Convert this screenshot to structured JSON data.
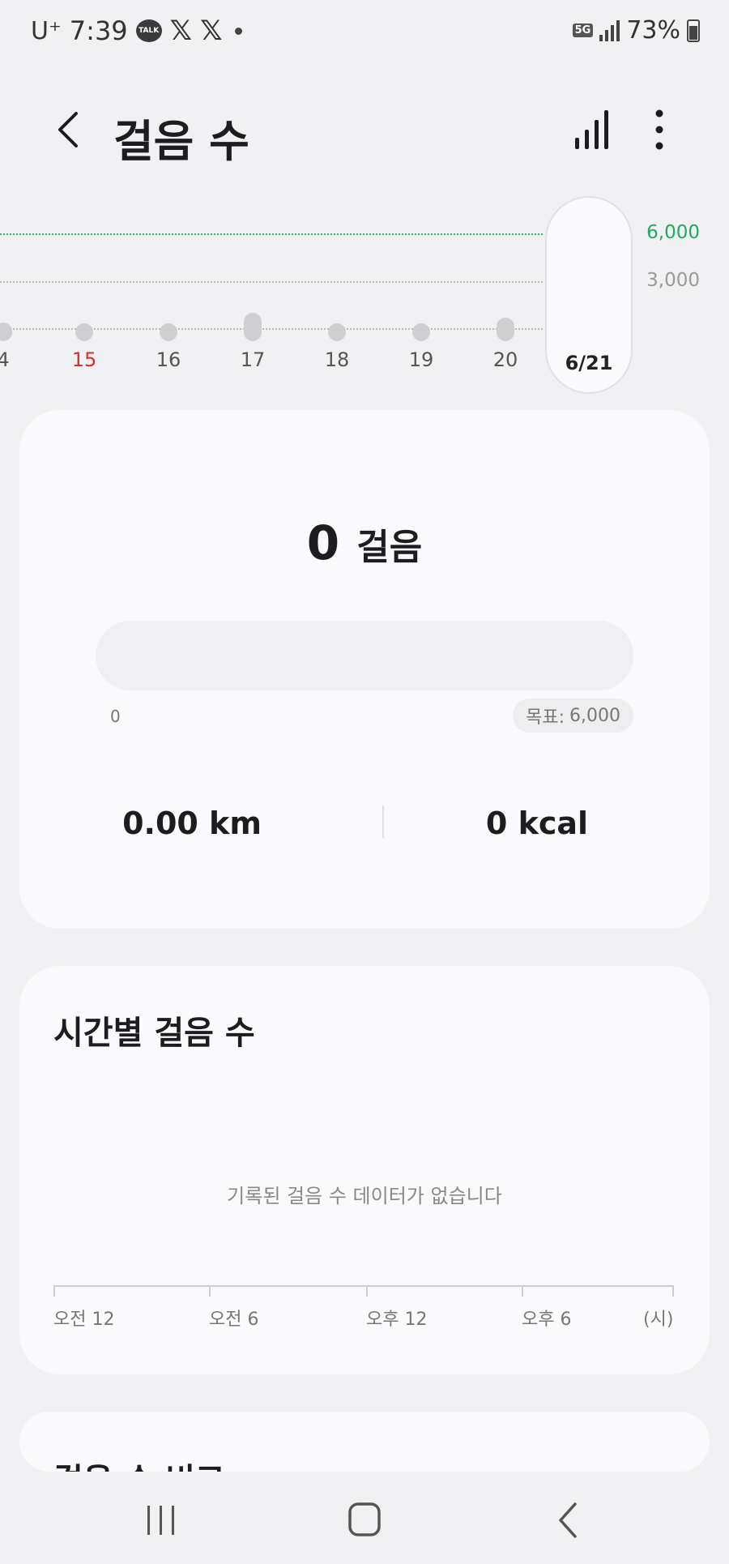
{
  "status_bar": {
    "carrier": "U⁺",
    "time": "7:39",
    "talk_label": "TALK",
    "x_glyph": "𝕏",
    "network": "5G",
    "battery": "73%"
  },
  "header": {
    "title": "걸음 수"
  },
  "weekly": {
    "goal_line": "6,000",
    "mid_line": "3,000",
    "days": [
      {
        "label": "4",
        "steps": 1200,
        "color": "normal"
      },
      {
        "label": "15",
        "steps": 300,
        "color": "red"
      },
      {
        "label": "16",
        "steps": 500,
        "color": "normal"
      },
      {
        "label": "17",
        "steps": 1800,
        "color": "normal"
      },
      {
        "label": "18",
        "steps": 300,
        "color": "normal"
      },
      {
        "label": "19",
        "steps": 300,
        "color": "normal"
      },
      {
        "label": "20",
        "steps": 1500,
        "color": "normal"
      }
    ],
    "selected": {
      "label": "6/21",
      "steps": 0
    }
  },
  "summary": {
    "steps": "0",
    "steps_unit": "걸음",
    "progress_fraction": 0,
    "progress_min": "0",
    "goal_label": "목표:",
    "goal_value": "6,000",
    "distance": "0.00 km",
    "calories": "0 kcal"
  },
  "hourly": {
    "title": "시간별 걸음 수",
    "empty_message": "기록된 걸음 수 데이터가 없습니다",
    "axis_labels": [
      "오전 12",
      "오전 6",
      "오후 12",
      "오후 6",
      "(시)"
    ]
  },
  "compare": {
    "title": "걸음 수 비교"
  }
}
